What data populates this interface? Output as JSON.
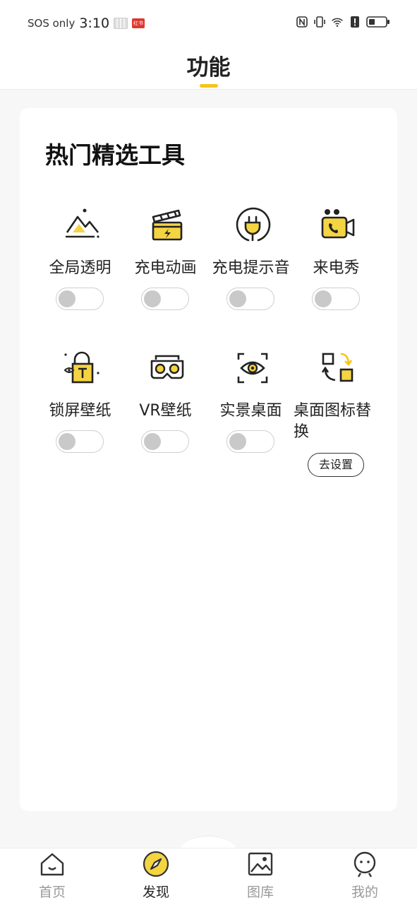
{
  "status_bar": {
    "carrier": "SOS only",
    "time": "3:10",
    "icons": [
      "gallery-notification-icon",
      "app-notification-icon",
      "nfc-icon",
      "vibrate-icon",
      "wifi-icon",
      "alert-icon",
      "battery-icon"
    ],
    "app_badge": "红书",
    "colors": {
      "notification_red": "#e0362e"
    }
  },
  "header": {
    "title": "功能",
    "accent_color": "#f5c518"
  },
  "section": {
    "title": "热门精选工具"
  },
  "tools": [
    {
      "label": "全局透明",
      "icon": "mountain-sun-icon",
      "control": "toggle",
      "on": false
    },
    {
      "label": "充电动画",
      "icon": "clapperboard-bolt-icon",
      "control": "toggle",
      "on": false
    },
    {
      "label": "充电提示音",
      "icon": "plug-icon",
      "control": "toggle",
      "on": false
    },
    {
      "label": "来电秀",
      "icon": "video-call-icon",
      "control": "toggle",
      "on": false
    },
    {
      "label": "锁屏壁纸",
      "icon": "lock-t-icon",
      "control": "toggle",
      "on": false
    },
    {
      "label": "VR壁纸",
      "icon": "vr-goggles-icon",
      "control": "toggle",
      "on": false
    },
    {
      "label": "实景桌面",
      "icon": "scan-eye-icon",
      "control": "toggle",
      "on": false
    },
    {
      "label": "桌面图标替换",
      "icon": "swap-icons-icon",
      "control": "button",
      "button_label": "去设置"
    }
  ],
  "tabbar": {
    "tabs": [
      {
        "label": "首页",
        "icon": "home-icon",
        "active": false
      },
      {
        "label": "发现",
        "icon": "compass-icon",
        "active": true
      },
      {
        "label": "图库",
        "icon": "gallery-icon",
        "active": false
      },
      {
        "label": "我的",
        "icon": "profile-face-icon",
        "active": false
      }
    ]
  }
}
